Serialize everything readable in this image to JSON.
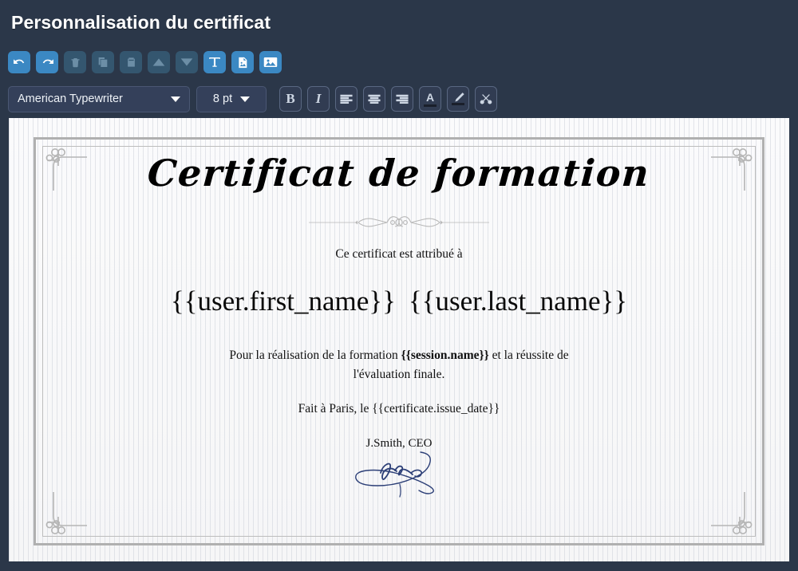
{
  "header": {
    "title": "Personnalisation du certificat"
  },
  "toolbar": {
    "actions": [
      {
        "name": "undo-button",
        "icon": "undo-icon",
        "state": "enabled",
        "label": "Annuler"
      },
      {
        "name": "redo-button",
        "icon": "redo-icon",
        "state": "enabled",
        "label": "Rétablir"
      },
      {
        "name": "delete-button",
        "icon": "trash-icon",
        "state": "disabled",
        "label": "Supprimer"
      },
      {
        "name": "copy-button",
        "icon": "copy-icon",
        "state": "disabled",
        "label": "Copier"
      },
      {
        "name": "paste-button",
        "icon": "paste-icon",
        "state": "disabled",
        "label": "Coller"
      },
      {
        "name": "move-up-button",
        "icon": "arrow-up-icon",
        "state": "disabled",
        "label": "Monter"
      },
      {
        "name": "move-down-button",
        "icon": "arrow-down-icon",
        "state": "disabled",
        "label": "Descendre"
      },
      {
        "name": "add-text-button",
        "icon": "text-t-icon",
        "state": "enabled",
        "label": "Texte"
      },
      {
        "name": "add-document-button",
        "icon": "document-image-icon",
        "state": "enabled",
        "label": "Document"
      },
      {
        "name": "add-image-button",
        "icon": "picture-icon",
        "state": "enabled",
        "label": "Image"
      }
    ],
    "font_family": {
      "value": "American Typewriter",
      "caret_icon": "chevron-down-icon"
    },
    "font_size": {
      "value": "8 pt",
      "caret_icon": "chevron-down-icon"
    },
    "format_buttons": [
      {
        "name": "bold-button",
        "icon": "bold-icon",
        "label": "B"
      },
      {
        "name": "italic-button",
        "icon": "italic-icon",
        "label": "I"
      },
      {
        "name": "align-left-button",
        "icon": "align-left-icon",
        "label": ""
      },
      {
        "name": "align-center-button",
        "icon": "align-center-icon",
        "label": ""
      },
      {
        "name": "align-right-button",
        "icon": "align-right-icon",
        "label": ""
      },
      {
        "name": "text-color-button",
        "icon": "text-color-a-icon",
        "label": "A"
      },
      {
        "name": "highlight-button",
        "icon": "pencil-icon",
        "label": ""
      },
      {
        "name": "clear-format-button",
        "icon": "scissors-icon",
        "label": ""
      }
    ]
  },
  "certificate": {
    "title": "Certificat de formation",
    "attributed_to_label": "Ce certificat est attribué à",
    "recipient_first_name": "{{user.first_name}}",
    "recipient_last_name": "{{user.last_name}}",
    "body_prefix": "Pour la réalisation de la formation ",
    "body_session_token": "{{session.name}}",
    "body_suffix": " et la réussite de l'évaluation finale.",
    "issue_line_prefix": "Fait à Paris, le ",
    "issue_date_token": "{{certificate.issue_date}}",
    "signer": "J.Smith, CEO",
    "signature_alt": "signature-mark"
  },
  "colors": {
    "chrome_background": "#2b3749",
    "accent_blue": "#3b88c3",
    "disabled_blue": "#34566f",
    "page_background": "#f8f8f9",
    "frame_gray": "#b0b0b0",
    "signature_ink": "#2c3f77"
  }
}
